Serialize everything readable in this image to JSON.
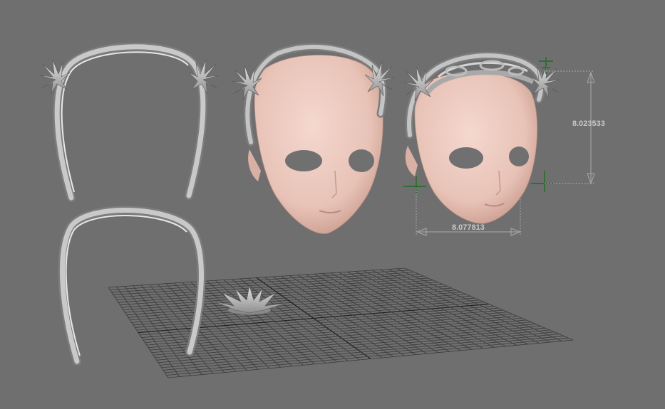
{
  "viewport": {
    "background": "#6f6f6f",
    "grid_color": "#3a3a3a",
    "mesh_gray": "#b5b5b5",
    "skin_color": "#efcdc3",
    "gizmo_color": "#1f6e1f"
  },
  "dimensions": {
    "height_value": "8.023533",
    "width_value": "8.077813"
  }
}
